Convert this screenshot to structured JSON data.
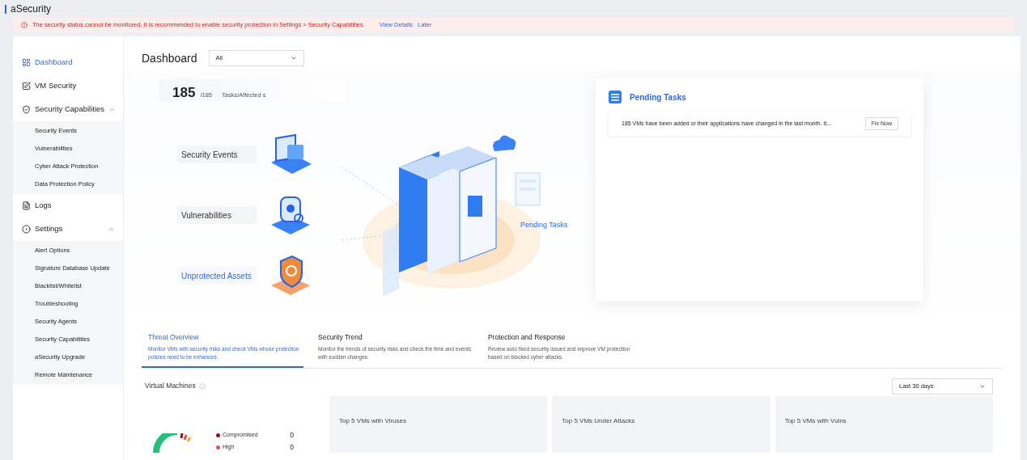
{
  "app": {
    "title": "aSecurity"
  },
  "alert": {
    "message": "The security status cannot be monitored. It is recommended to enable security protection in Settings > Security Capabilities.",
    "links": [
      "View Details",
      "Later"
    ]
  },
  "sidebar": {
    "items": [
      {
        "label": "Dashboard",
        "kind": "dashboard",
        "selected": true
      },
      {
        "label": "VM Security",
        "kind": "vm",
        "selected": false
      },
      {
        "label": "Security Capabilities",
        "kind": "shield",
        "selected": false,
        "expanded": true,
        "children": [
          {
            "label": "Security Events",
            "selected": false
          },
          {
            "label": "Vulnerabilities",
            "selected": false
          },
          {
            "label": "Cyber Attack Protection",
            "selected": false
          },
          {
            "label": "Data Protection Policy",
            "selected": false
          }
        ]
      },
      {
        "label": "Logs",
        "kind": "logs",
        "selected": false
      },
      {
        "label": "Settings",
        "kind": "settings",
        "selected": false,
        "expanded": true,
        "children": [
          {
            "label": "Alert Options",
            "selected": false
          },
          {
            "label": "Signature Database Update",
            "selected": false
          },
          {
            "label": "Blacklist/Whitelist",
            "selected": false
          },
          {
            "label": "Troubleshooting",
            "selected": false
          },
          {
            "label": "Security Agents",
            "selected": false
          },
          {
            "label": "Security Capabilities",
            "selected": false
          },
          {
            "label": "aSecurity Upgrade",
            "selected": false
          },
          {
            "label": "Remote Maintenance",
            "selected": false
          }
        ]
      }
    ]
  },
  "header": {
    "title": "Dashboard",
    "scope_select": "All"
  },
  "overview": {
    "count": "185",
    "total": "/185",
    "caption": "Tasks/Affected s",
    "nodes": [
      {
        "label": "Security Events",
        "kind": "laptop",
        "highlighted": false
      },
      {
        "label": "Vulnerabilities",
        "kind": "bug",
        "highlighted": false
      },
      {
        "label": "Unprotected Assets",
        "kind": "shield",
        "highlighted": true
      }
    ],
    "pending_label": "Pending Tasks"
  },
  "pending_tasks": {
    "title": "Pending Tasks",
    "items": [
      {
        "text": "185 VMs have been added or their applications have changed in the last month. It...",
        "action": "Fix Now"
      }
    ]
  },
  "tabs": [
    {
      "title": "Threat Overview",
      "description": "Monitor VMs with security risks and check VMs whose protection policies need to be enhanced.",
      "selected": true
    },
    {
      "title": "Security Trend",
      "description": "Monitor the trends of security risks and check the time and events with sudden changes.",
      "selected": false
    },
    {
      "title": "Protection and Response",
      "description": "Review auto fixed security issues and improve VM protection based on blocked cyber attacks.",
      "selected": false
    }
  ],
  "virtual_machines": {
    "title": "Virtual Machines",
    "legend": [
      {
        "label": "Compromised",
        "value": "0",
        "color": "#a8071a"
      },
      {
        "label": "High",
        "value": "0",
        "color": "#f5484d"
      }
    ]
  },
  "period_select": "Last 30 days",
  "cards": [
    "Top 5 VMs with Viruses",
    "Top 5 VMs Under Attacks",
    "Top 5 VMs with Vulns"
  ]
}
